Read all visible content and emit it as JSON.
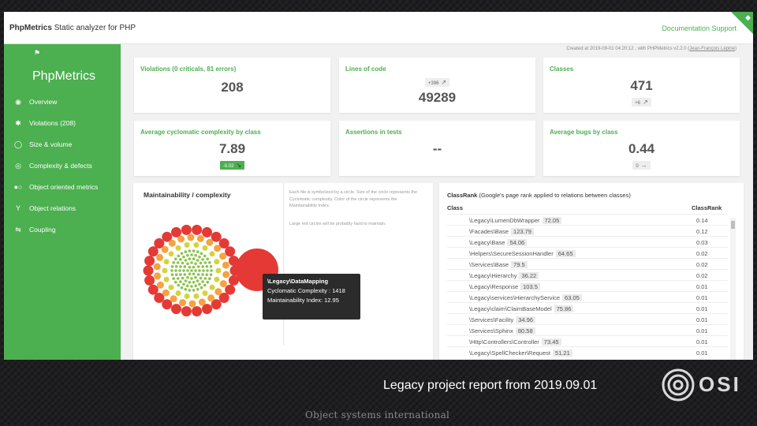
{
  "app": {
    "brand_bold": "PhpMetrics",
    "brand_rest": "Static analyzer for PHP",
    "doc_link": "Documentation Support",
    "meta_prefix": "Created at 2019-09-01 04:20:12 , with PHPMetrics v2.2.0 (",
    "meta_author": "Jean-François Lépine",
    "meta_suffix": ")"
  },
  "sidebar": {
    "title": "PhpMetrics",
    "items": [
      {
        "label": "Overview",
        "icon": "eye-icon"
      },
      {
        "label": "Violations (208)",
        "icon": "bug-icon"
      },
      {
        "label": "Size & volume",
        "icon": "circle-icon"
      },
      {
        "label": "Complexity & defects",
        "icon": "layers-icon"
      },
      {
        "label": "Object oriented metrics",
        "icon": "dots-icon"
      },
      {
        "label": "Object relations",
        "icon": "fork-icon"
      },
      {
        "label": "Coupling",
        "icon": "coupling-icon"
      }
    ]
  },
  "cards": {
    "violations": {
      "title": "Violations (0 criticals, 81 errors)",
      "value": "208"
    },
    "loc": {
      "title": "Lines of code",
      "value": "49289",
      "trend": "+396"
    },
    "classes": {
      "title": "Classes",
      "value": "471",
      "trend": "+6"
    },
    "ccn": {
      "title": "Average cyclomatic complexity by class",
      "value": "7.89",
      "trend": "-0.02"
    },
    "assertions": {
      "title": "Assertions in tests",
      "value": "--"
    },
    "bugs": {
      "title": "Average bugs by class",
      "value": "0.44",
      "trend": "0"
    }
  },
  "maintainability": {
    "title": "Maintainability / complexity",
    "description": "Each file is symbolized by a circle. Size of the circle represents the Cyclomatic complexity. Color of the circle represents the Maintainability Index.",
    "note": "Large red circles will be probably hard to maintain.",
    "tooltip": {
      "name": "\\Legacy\\DataMapping",
      "ccn": "Cyclomatic Complexity : 1418",
      "mi": "Maintainability Index: 12.95"
    }
  },
  "classrank": {
    "title_bold": "ClassRank",
    "title_rest": "(Google's page rank applied to relations between classes)",
    "col_class": "Class",
    "col_rank": "ClassRank",
    "rows": [
      {
        "name": "\\Legacy\\LumenDbWrapper",
        "mi": "72.05",
        "rank": "0.14"
      },
      {
        "name": "\\Facades\\Base",
        "mi": "123.79",
        "rank": "0.12"
      },
      {
        "name": "\\Legacy\\Base",
        "mi": "54.06",
        "rank": "0.03"
      },
      {
        "name": "\\Helpers\\SecureSessionHandler",
        "mi": "64.65",
        "rank": "0.02"
      },
      {
        "name": "\\Services\\Base",
        "mi": "79.5",
        "rank": "0.02"
      },
      {
        "name": "\\Legacy\\Hierarchy",
        "mi": "36.22",
        "rank": "0.02"
      },
      {
        "name": "\\Legacy\\Response",
        "mi": "103.5",
        "rank": "0.01"
      },
      {
        "name": "\\Legacy\\services\\HierarchyService",
        "mi": "63.05",
        "rank": "0.01"
      },
      {
        "name": "\\Legacy\\claim\\ClaimBaseModel",
        "mi": "75.86",
        "rank": "0.01"
      },
      {
        "name": "\\Services\\Facility",
        "mi": "34.96",
        "rank": "0.01"
      },
      {
        "name": "\\Services\\Sphinx",
        "mi": "80.58",
        "rank": "0.01"
      },
      {
        "name": "\\Http\\Controllers\\Controller",
        "mi": "73.45",
        "rank": "0.01"
      },
      {
        "name": "\\Legacy\\SpellChecker\\Request",
        "mi": "51.21",
        "rank": "0.01"
      }
    ]
  },
  "slide": {
    "caption": "Legacy project report from 2019.09.01",
    "footer": "Object systems international",
    "logo_text": "OSI"
  },
  "colors": {
    "accent": "#4caf50",
    "bubble_red": "#e53935",
    "bubble_orange": "#f4a340",
    "bubble_yellow": "#d4d43a",
    "bubble_green": "#8bc34a"
  }
}
